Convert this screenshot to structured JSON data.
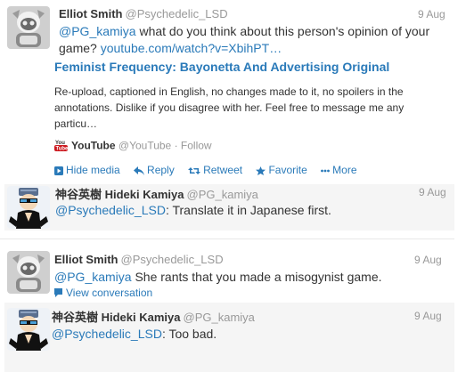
{
  "tweets": [
    {
      "fullname": "Elliot Smith",
      "handle": "@Psychedelic_LSD",
      "time": "9 Aug",
      "mention": "@PG_kamiya",
      "text_line1_rest": " what do you think about this person's opinion of your",
      "text_line2_pre": "game? ",
      "link": "youtube.com/watch?v=XbihPT…",
      "card": {
        "title": "Feminist Frequency: Bayonetta And Advertising Original",
        "desc": "Re-upload, captioned in English, no changes made to it, no spoilers in the annotations. Dislike if you disagree with her. Feel free to message me any particu…",
        "source_name": "YouTube",
        "source_handle": "@YouTube",
        "follow": "Follow",
        "dot": "·"
      },
      "actions": {
        "hide_media": "Hide media",
        "reply": "Reply",
        "retweet": "Retweet",
        "favorite": "Favorite",
        "more": "More"
      }
    },
    {
      "fullname": "神谷英樹 Hideki Kamiya",
      "handle": "@PG_kamiya",
      "time": "9 Aug",
      "mention": "@Psychedelic_LSD",
      "text": ": Translate it in Japanese first."
    },
    {
      "fullname": "Elliot Smith",
      "handle": "@Psychedelic_LSD",
      "time": "9 Aug",
      "mention": "@PG_kamiya",
      "text": " She rants that you made a misogynist game.",
      "view_conversation": "View conversation"
    },
    {
      "fullname": "神谷英樹 Hideki Kamiya",
      "handle": "@PG_kamiya",
      "time": "9 Aug",
      "mention": "@Psychedelic_LSD",
      "text": ": Too bad."
    }
  ],
  "colors": {
    "link": "#2a7ab9",
    "muted": "#999999",
    "highlight_bg": "#f5f5f5"
  },
  "icons": [
    "avatar-elliot",
    "avatar-kamiya",
    "youtube-logo",
    "media-icon",
    "reply-icon",
    "retweet-icon",
    "favorite-icon",
    "more-icon",
    "conversation-icon"
  ]
}
